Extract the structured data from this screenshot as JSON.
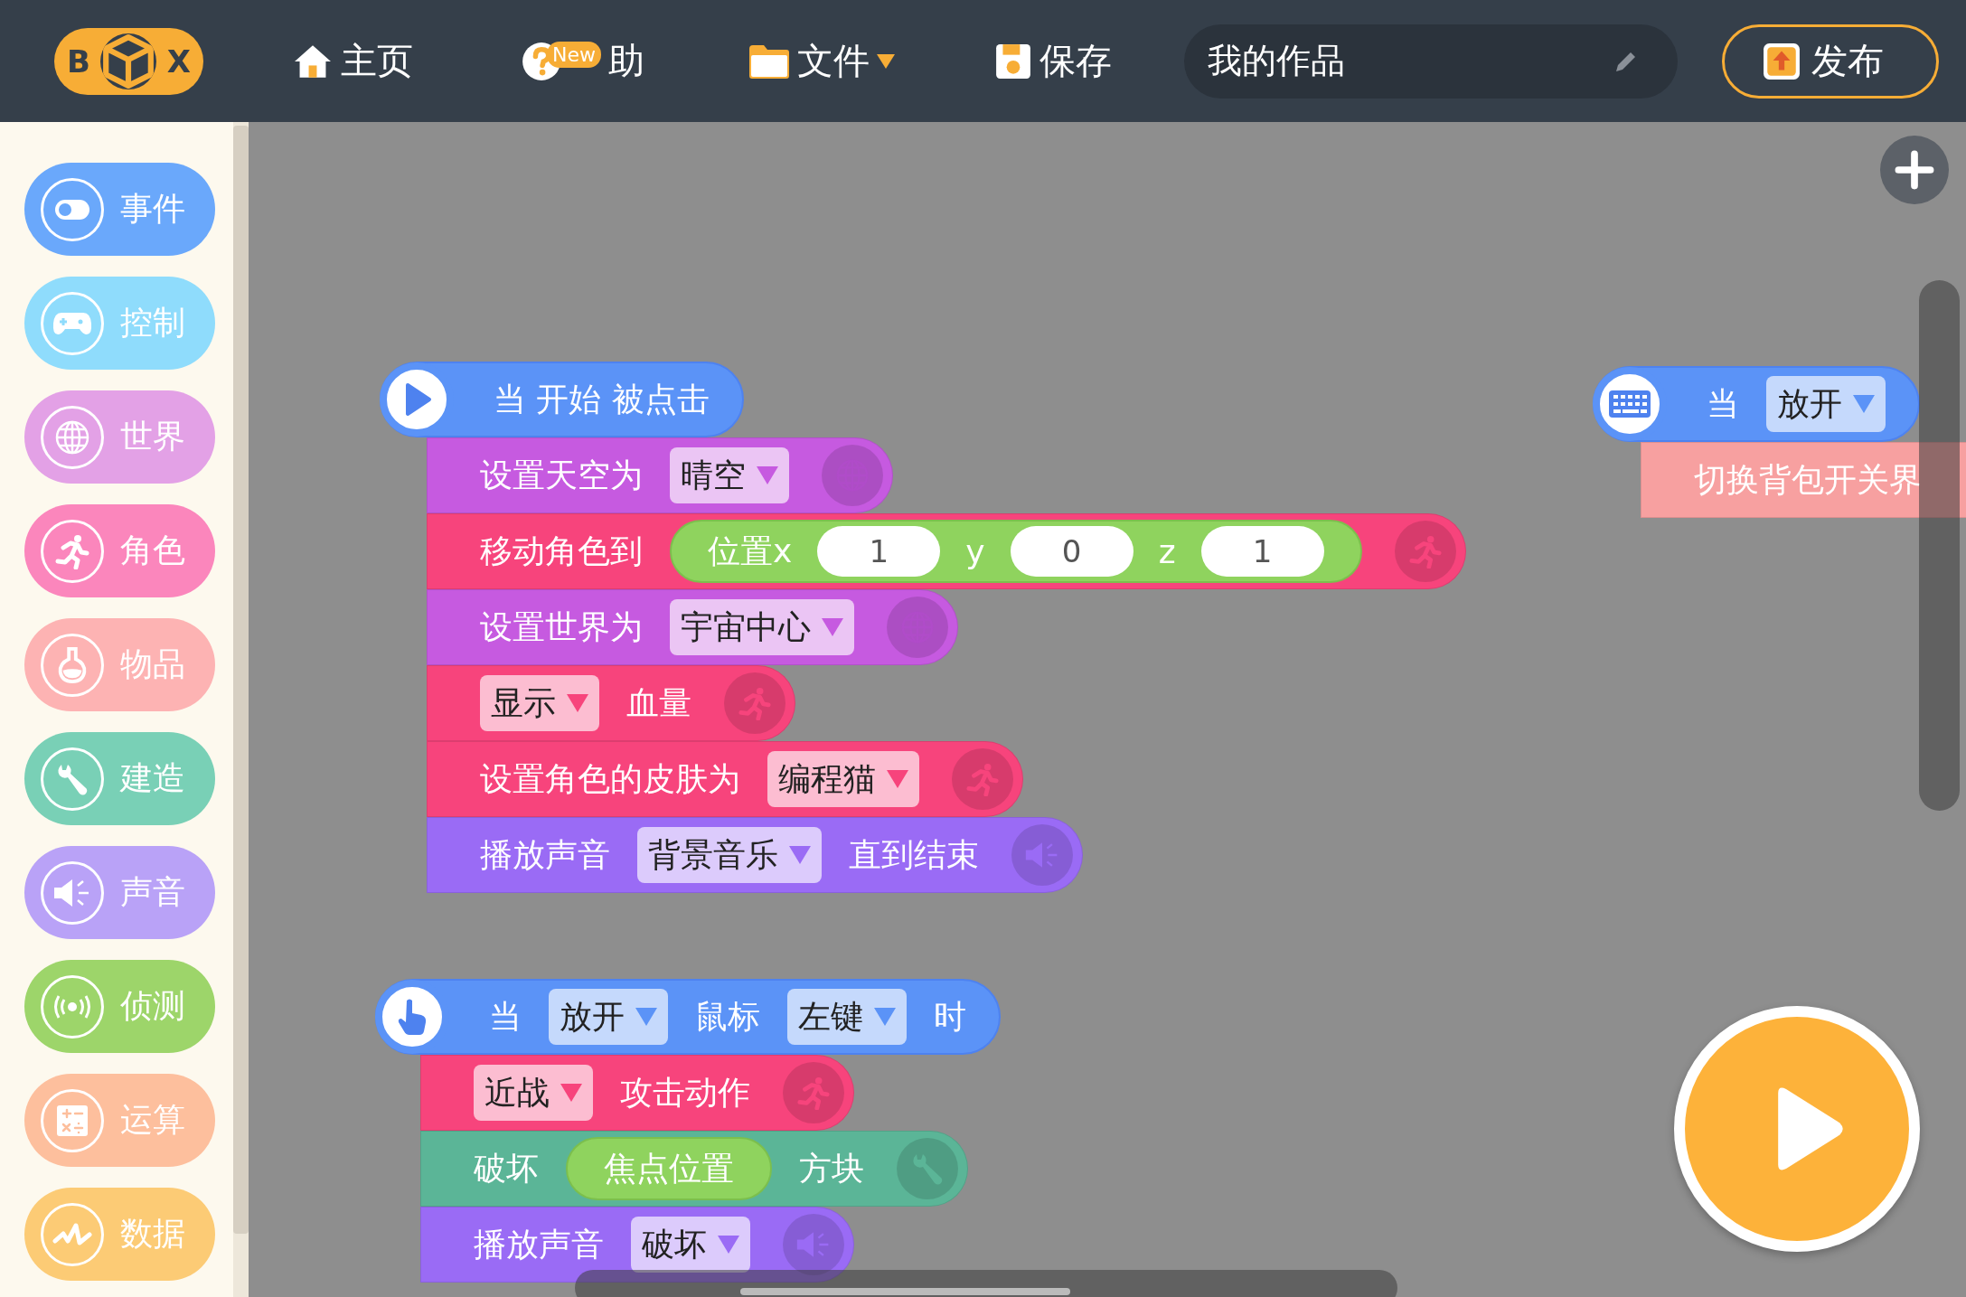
{
  "topbar": {
    "logo": [
      "B",
      "X"
    ],
    "nav": [
      {
        "kind": "home",
        "label": "主页",
        "dropdown": false
      },
      {
        "kind": "help",
        "label": "助",
        "badge": "New",
        "dropdown": false
      },
      {
        "kind": "file",
        "label": "文件",
        "dropdown": true
      },
      {
        "kind": "save",
        "label": "保存",
        "dropdown": false
      }
    ],
    "title_field": {
      "value": "我的作品"
    },
    "publish": {
      "label": "发布"
    }
  },
  "sidebar": {
    "categories": [
      {
        "label": "事件",
        "color": "#6aa8fb"
      },
      {
        "label": "控制",
        "color": "#8fdcfc"
      },
      {
        "label": "世界",
        "color": "#e3a1e6"
      },
      {
        "label": "角色",
        "color": "#fb86bc"
      },
      {
        "label": "物品",
        "color": "#fdb3b3"
      },
      {
        "label": "建造",
        "color": "#79d0b6"
      },
      {
        "label": "声音",
        "color": "#b9a2f7"
      },
      {
        "label": "侦测",
        "color": "#9dd56a"
      },
      {
        "label": "运算",
        "color": "#fdbf9d"
      },
      {
        "label": "数据",
        "color": "#fccb75"
      }
    ]
  },
  "canvas": {
    "stacks": [
      {
        "hat": {
          "kind": "start",
          "parts": [
            {
              "kind": "text",
              "text": "当 开始 被点击"
            }
          ]
        },
        "blocks": [
          {
            "kind": "world",
            "parts": [
              {
                "kind": "text",
                "text": "设置天空为"
              },
              {
                "kind": "dropdown",
                "text": "晴空"
              }
            ]
          },
          {
            "kind": "character",
            "parts": [
              {
                "kind": "text",
                "text": "移动角色到"
              },
              {
                "kind": "reporter",
                "parts": [
                  {
                    "kind": "text",
                    "text": "位置x"
                  },
                  {
                    "kind": "number",
                    "text": "1"
                  },
                  {
                    "kind": "text",
                    "text": "y"
                  },
                  {
                    "kind": "number",
                    "text": "0"
                  },
                  {
                    "kind": "text",
                    "text": "z"
                  },
                  {
                    "kind": "number",
                    "text": "1"
                  }
                ]
              }
            ]
          },
          {
            "kind": "world",
            "parts": [
              {
                "kind": "text",
                "text": "设置世界为"
              },
              {
                "kind": "dropdown",
                "text": "宇宙中心"
              }
            ]
          },
          {
            "kind": "character",
            "parts": [
              {
                "kind": "dropdown",
                "text": "显示"
              },
              {
                "kind": "text",
                "text": "血量"
              }
            ]
          },
          {
            "kind": "character",
            "parts": [
              {
                "kind": "text",
                "text": "设置角色的皮肤为"
              },
              {
                "kind": "dropdown",
                "text": "编程猫"
              }
            ]
          },
          {
            "kind": "sound",
            "parts": [
              {
                "kind": "text",
                "text": "播放声音"
              },
              {
                "kind": "dropdown",
                "text": "背景音乐"
              },
              {
                "kind": "text",
                "text": "直到结束"
              }
            ]
          }
        ]
      },
      {
        "hat": {
          "kind": "mouse",
          "parts": [
            {
              "kind": "text",
              "text": "当"
            },
            {
              "kind": "dropdown",
              "text": "放开"
            },
            {
              "kind": "text",
              "text": "鼠标"
            },
            {
              "kind": "dropdown",
              "text": "左键"
            },
            {
              "kind": "text",
              "text": "时"
            }
          ]
        },
        "blocks": [
          {
            "kind": "character",
            "parts": [
              {
                "kind": "dropdown",
                "text": "近战"
              },
              {
                "kind": "text",
                "text": "攻击动作"
              }
            ]
          },
          {
            "kind": "build",
            "parts": [
              {
                "kind": "text",
                "text": "破坏"
              },
              {
                "kind": "reporter",
                "parts": [
                  {
                    "kind": "text",
                    "text": "焦点位置"
                  }
                ]
              },
              {
                "kind": "text",
                "text": "方块"
              }
            ]
          },
          {
            "kind": "sound",
            "parts": [
              {
                "kind": "text",
                "text": "播放声音"
              },
              {
                "kind": "dropdown",
                "text": "破坏"
              }
            ]
          }
        ]
      },
      {
        "hat": {
          "kind": "key",
          "parts": [
            {
              "kind": "text",
              "text": "当"
            },
            {
              "kind": "dropdown",
              "text": "放开"
            }
          ]
        },
        "blocks": [
          {
            "kind": "interface",
            "parts": [
              {
                "kind": "text",
                "text": "切换背包开关界"
              }
            ]
          }
        ]
      }
    ]
  }
}
